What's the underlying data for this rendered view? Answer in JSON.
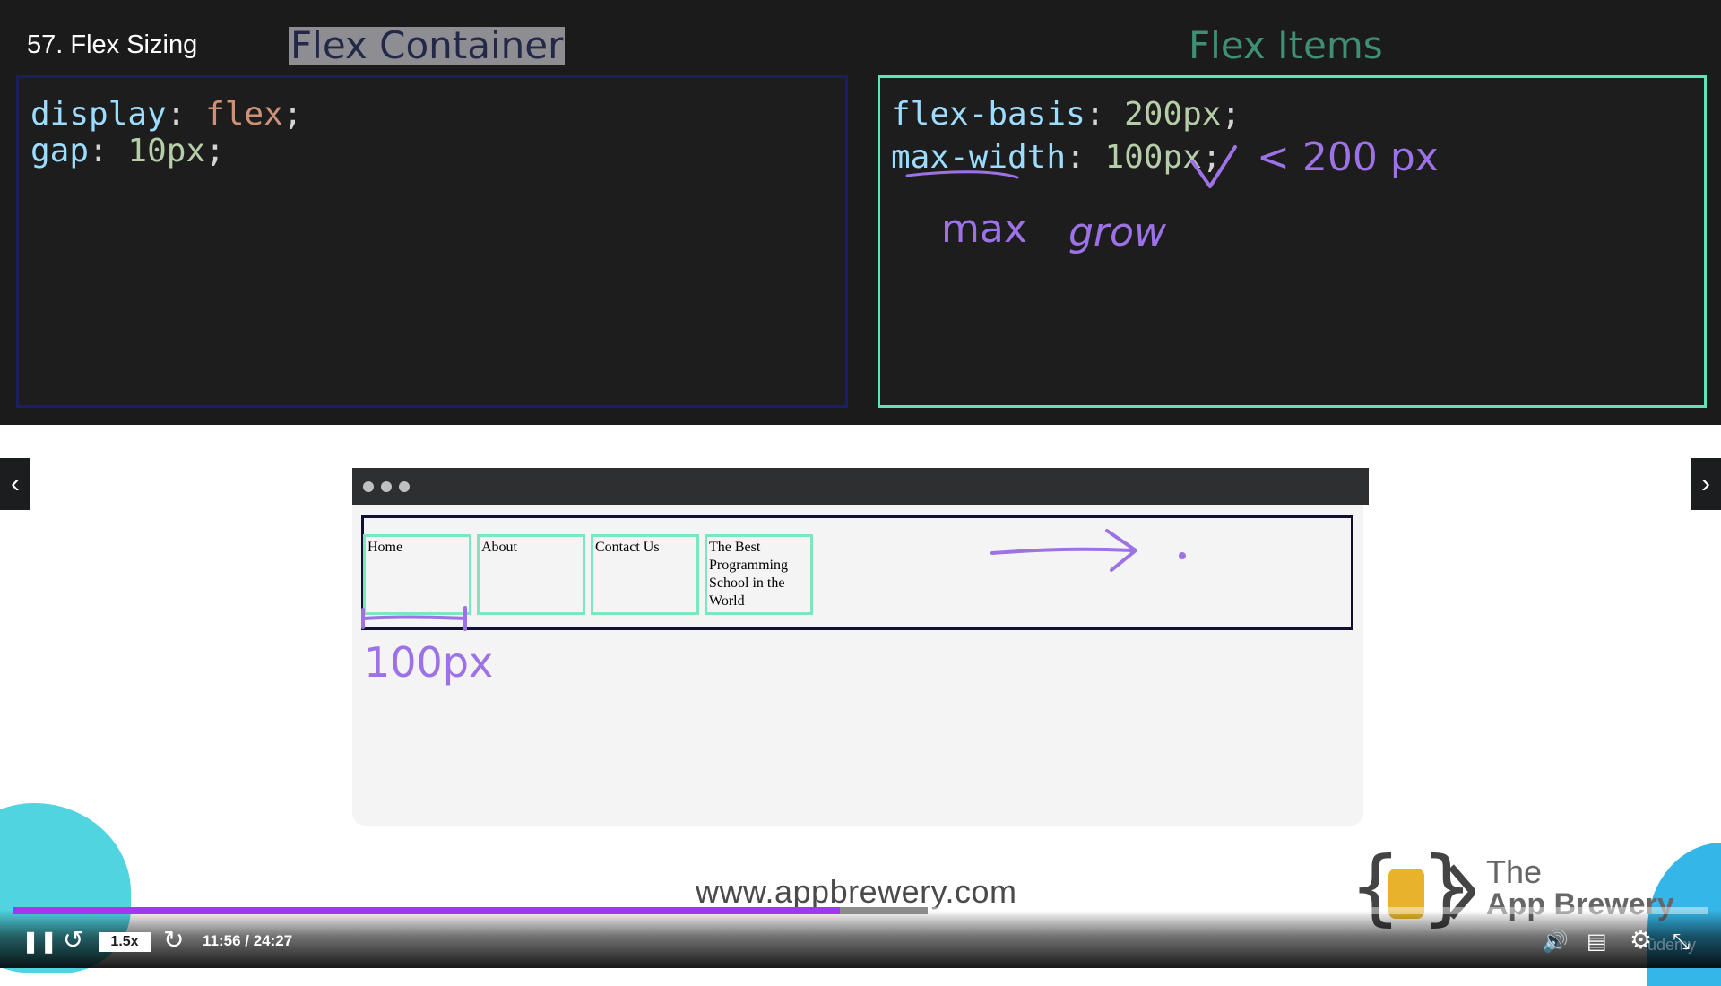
{
  "slide": {
    "lecture_title": "57. Flex Sizing",
    "container_heading": "Flex Container",
    "items_heading": "Flex Items",
    "container_code": [
      {
        "prop": "display",
        "value": "flex",
        "value_type": "string"
      },
      {
        "prop": "gap",
        "value": "10px",
        "value_type": "number"
      }
    ],
    "items_code": [
      {
        "prop": "flex-basis",
        "value": "200px"
      },
      {
        "prop": "max-width",
        "value": "100px"
      }
    ],
    "annotations": {
      "check": "✓",
      "compare": "< 200 px",
      "word_max": "max",
      "word_grow": "grow",
      "width_label": "100px"
    },
    "colors": {
      "accent_purple": "#9d72e6",
      "container_border": "#1b1e63",
      "items_border": "#5fe3b8"
    }
  },
  "browser_demo": {
    "items": [
      "Home",
      "About",
      "Contact Us",
      "The Best Programming School in the World"
    ]
  },
  "branding": {
    "website": "www.appbrewery.com",
    "brand_line1": "The",
    "brand_line2": "App Brewery",
    "logo_icon": "brackets-cup-logo"
  },
  "player": {
    "speed": "1.5x",
    "time": "11:56 / 24:27",
    "progress_fraction": 0.488,
    "watermark": "ūdemy",
    "icons": [
      "pause-icon",
      "rewind-icon",
      "forward-icon",
      "volume-icon",
      "captions-icon",
      "settings-icon",
      "exit-fullscreen-icon"
    ]
  }
}
